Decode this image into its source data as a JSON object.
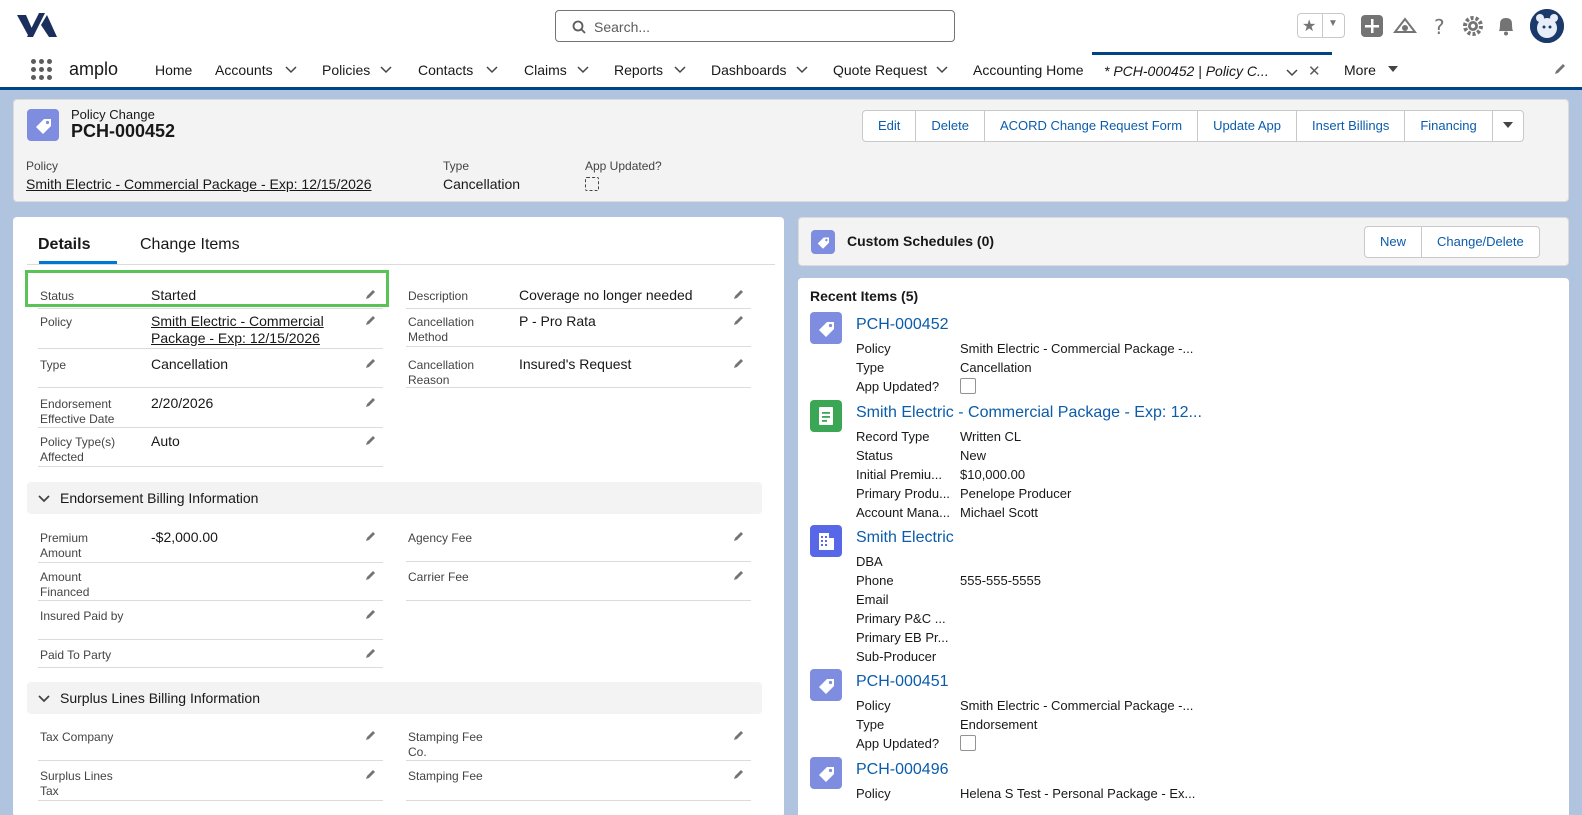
{
  "header": {
    "search_placeholder": "Search...",
    "app_name": "amplo"
  },
  "nav": {
    "items": [
      {
        "label": "Home"
      },
      {
        "label": "Accounts"
      },
      {
        "label": "Policies"
      },
      {
        "label": "Contacts"
      },
      {
        "label": "Claims"
      },
      {
        "label": "Reports"
      },
      {
        "label": "Dashboards"
      },
      {
        "label": "Quote Request"
      },
      {
        "label": "Accounting Home"
      }
    ],
    "active_tab": "* PCH-000452 | Policy C...",
    "more": "More"
  },
  "record": {
    "object_type": "Policy Change",
    "name": "PCH-000452",
    "buttons": [
      "Edit",
      "Delete",
      "ACORD Change Request Form",
      "Update App",
      "Insert Billings",
      "Financing"
    ],
    "highlights": {
      "policy_label": "Policy",
      "policy_value": "Smith Electric - Commercial Package - Exp: 12/15/2026",
      "type_label": "Type",
      "type_value": "Cancellation",
      "app_updated_label": "App Updated?"
    }
  },
  "tabs": {
    "details": "Details",
    "change_items": "Change Items"
  },
  "fields": {
    "status": {
      "label": "Status",
      "value": "Started"
    },
    "policy": {
      "label": "Policy",
      "value": "Smith Electric - Commercial Package - Exp: 12/15/2026"
    },
    "type": {
      "label": "Type",
      "value": "Cancellation"
    },
    "endorsement_date": {
      "label": "Endorsement Effective Date",
      "value": "2/20/2026"
    },
    "policy_types": {
      "label": "Policy Type(s) Affected",
      "value": "Auto"
    },
    "description": {
      "label": "Description",
      "value": "Coverage no longer needed"
    },
    "cancellation_method": {
      "label": "Cancellation Method",
      "value": "P - Pro Rata"
    },
    "cancellation_reason": {
      "label": "Cancellation Reason",
      "value": "Insured's Request"
    }
  },
  "endorsement_section": {
    "title": "Endorsement Billing Information",
    "premium_amount": {
      "label": "Premium Amount",
      "value": "-$2,000.00"
    },
    "amount_financed": {
      "label": "Amount Financed",
      "value": ""
    },
    "insured_paid_by": {
      "label": "Insured Paid by",
      "value": ""
    },
    "paid_to_party": {
      "label": "Paid To Party",
      "value": ""
    },
    "agency_fee": {
      "label": "Agency Fee",
      "value": ""
    },
    "carrier_fee": {
      "label": "Carrier Fee",
      "value": ""
    }
  },
  "surplus_section": {
    "title": "Surplus Lines Billing Information",
    "tax_company": {
      "label": "Tax Company",
      "value": ""
    },
    "surplus_lines_tax": {
      "label": "Surplus Lines Tax",
      "value": ""
    },
    "stamping_fee_co": {
      "label": "Stamping Fee Co.",
      "value": ""
    },
    "stamping_fee": {
      "label": "Stamping Fee",
      "value": ""
    }
  },
  "custom_schedules": {
    "title": "Custom Schedules (0)",
    "new_button": "New",
    "change_delete_button": "Change/Delete"
  },
  "recent_items": {
    "title": "Recent Items (5)",
    "items": [
      {
        "title": "PCH-000452",
        "rows": [
          [
            "Policy",
            "Smith Electric - Commercial Package -..."
          ],
          [
            "Type",
            "Cancellation"
          ],
          [
            "App Updated?",
            ""
          ]
        ]
      },
      {
        "title": "Smith Electric - Commercial Package - Exp: 12...",
        "rows": [
          [
            "Record Type",
            "Written CL"
          ],
          [
            "Status",
            "New"
          ],
          [
            "Initial Premiu...",
            "$10,000.00"
          ],
          [
            "Primary Produ...",
            "Penelope Producer"
          ],
          [
            "Account Mana...",
            "Michael Scott"
          ]
        ]
      },
      {
        "title": "Smith Electric",
        "rows": [
          [
            "DBA",
            ""
          ],
          [
            "Phone",
            "555-555-5555"
          ],
          [
            "Email",
            ""
          ],
          [
            "Primary P&C ...",
            ""
          ],
          [
            "Primary EB Pr...",
            ""
          ],
          [
            "Sub-Producer",
            ""
          ]
        ]
      },
      {
        "title": "PCH-000451",
        "rows": [
          [
            "Policy",
            "Smith Electric - Commercial Package -..."
          ],
          [
            "Type",
            "Endorsement"
          ],
          [
            "App Updated?",
            ""
          ]
        ]
      },
      {
        "title": "PCH-000496",
        "rows": [
          [
            "Policy",
            "Helena S Test - Personal Package - Ex..."
          ]
        ]
      }
    ]
  },
  "colors": {
    "brand_navy": "#014486",
    "link_blue": "#0b5cab",
    "highlight_green": "#5ac358",
    "policy_change_icon": "#7f8de1",
    "policy_icon": "#3ba755",
    "account_icon": "#5867e8"
  }
}
